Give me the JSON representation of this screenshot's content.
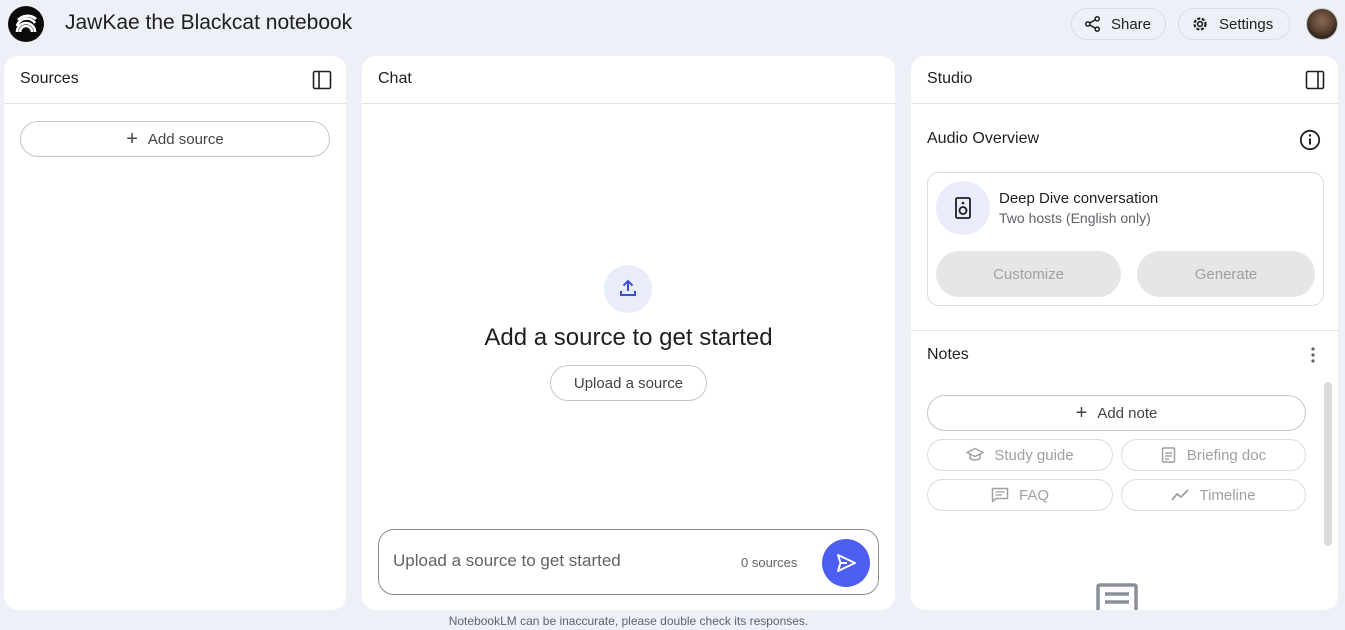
{
  "header": {
    "title": "JawKae the Blackcat notebook",
    "share_label": "Share",
    "settings_label": "Settings"
  },
  "sources": {
    "title": "Sources",
    "add_source_label": "Add source"
  },
  "chat": {
    "title": "Chat",
    "empty_heading": "Add a source to get started",
    "upload_label": "Upload a source",
    "input_placeholder": "Upload a source to get started",
    "source_count": "0 sources",
    "disclaimer": "NotebookLM can be inaccurate, please double check its responses."
  },
  "studio": {
    "title": "Studio",
    "audio_overview": {
      "title": "Audio Overview",
      "card_title": "Deep Dive conversation",
      "card_subtitle": "Two hosts (English only)",
      "customize_label": "Customize",
      "generate_label": "Generate"
    },
    "notes": {
      "title": "Notes",
      "add_note_label": "Add note",
      "study_guide_label": "Study guide",
      "briefing_doc_label": "Briefing doc",
      "faq_label": "FAQ",
      "timeline_label": "Timeline"
    }
  },
  "colors": {
    "background": "#eef0f8",
    "accent": "#4c5df2",
    "disabled_button": "#e6e6e6"
  }
}
